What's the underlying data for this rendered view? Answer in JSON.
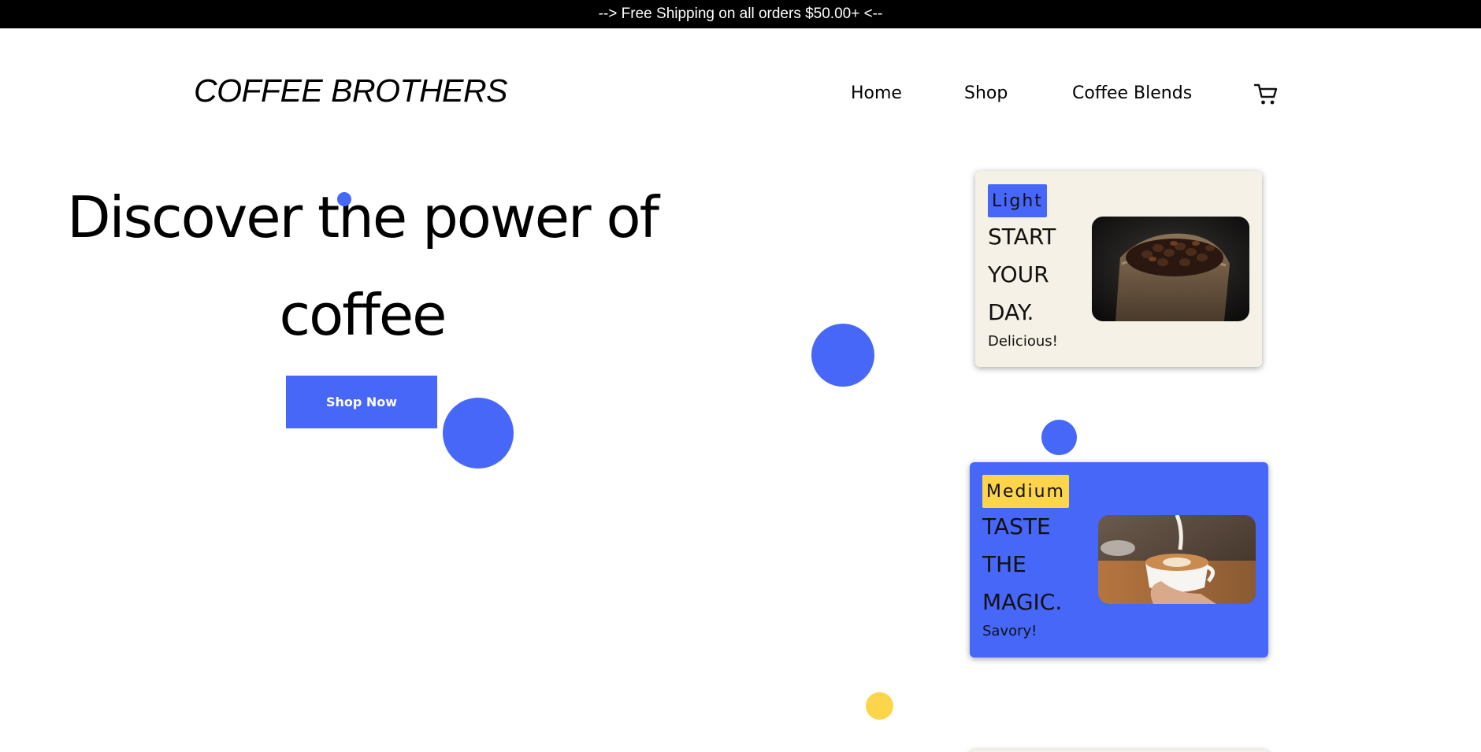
{
  "promo": {
    "text": "--> Free Shipping on all orders $50.00+ <--"
  },
  "header": {
    "brand": "COFFEE BROTHERS",
    "nav": {
      "home": "Home",
      "shop": "Shop",
      "blends": "Coffee Blends"
    },
    "cart_icon": "shopping-cart-icon"
  },
  "hero": {
    "title": "Discover the power of coffee",
    "cta_label": "Shop Now"
  },
  "cards": [
    {
      "badge": "Light",
      "heading": "START YOUR DAY.",
      "subtitle": "Delicious!",
      "image": "coffee-beans-sack-image"
    },
    {
      "badge": "Medium",
      "heading": "TASTE THE MAGIC.",
      "subtitle": "Savory!",
      "image": "latte-art-cup-image"
    }
  ],
  "colors": {
    "accent_blue": "#4767f8",
    "accent_yellow": "#fdd54b",
    "card_cream": "#f5f1e6",
    "promo_bg": "#000000"
  }
}
